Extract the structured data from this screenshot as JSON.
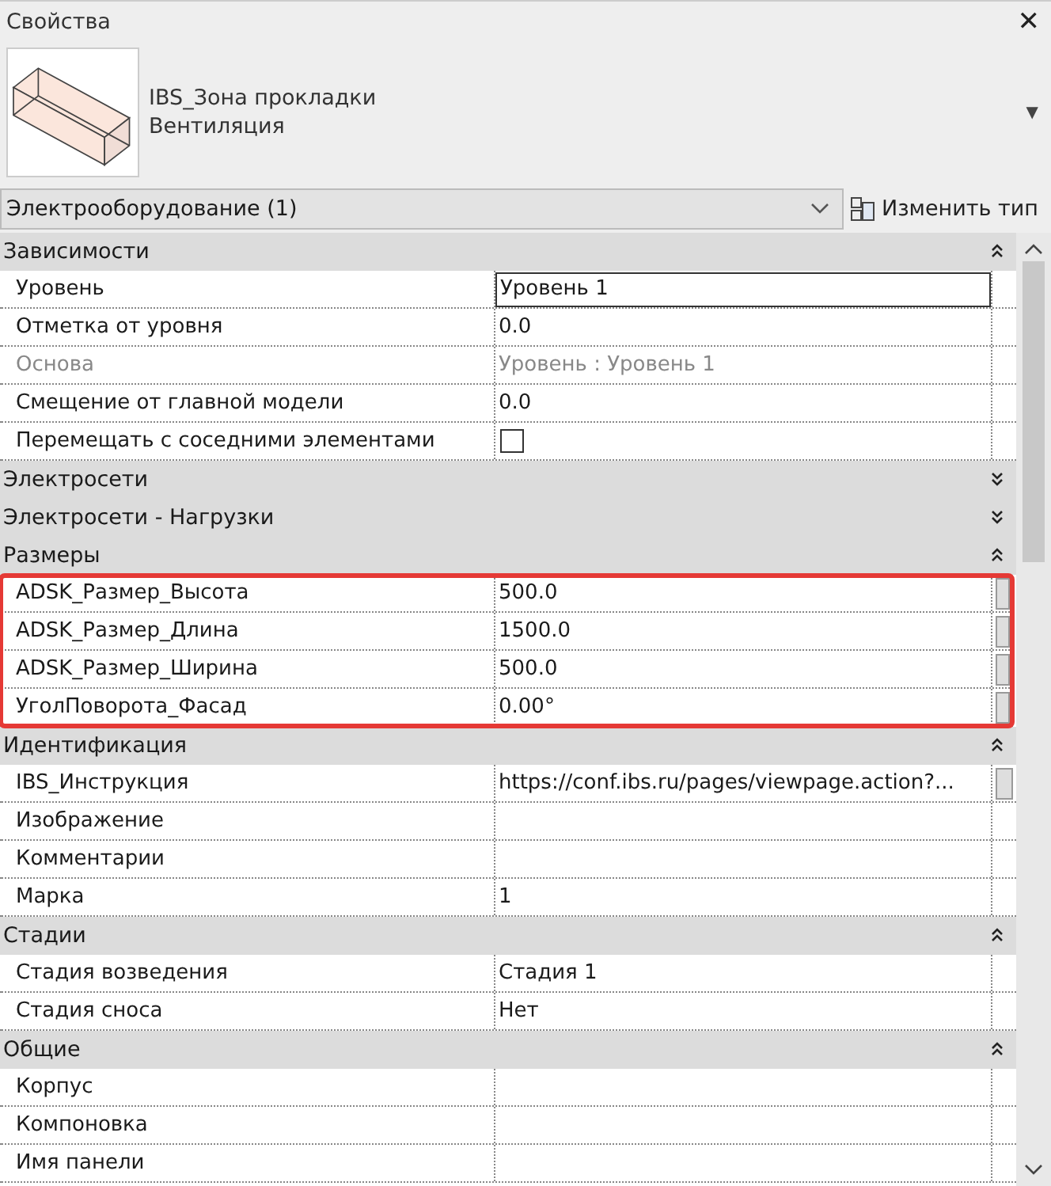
{
  "window": {
    "title": "Свойства",
    "close": "✕"
  },
  "type_selector": {
    "family": "IBS_Зона прокладки",
    "type": "Вентиляция",
    "dropdown": "▼"
  },
  "filter": {
    "value": "Электрооборудование (1)",
    "edit_type_button": "Изменить тип"
  },
  "groups": [
    {
      "name": "Зависимости",
      "expanded": true,
      "highlighted": false,
      "rows": [
        {
          "kind": "text",
          "label": "Уровень",
          "value": "Уровень 1",
          "editing": true,
          "disabled": false,
          "has_button": false
        },
        {
          "kind": "text",
          "label": "Отметка от уровня",
          "value": "0.0",
          "editing": false,
          "disabled": false,
          "has_button": false
        },
        {
          "kind": "text",
          "label": "Основа",
          "value": "Уровень : Уровень 1",
          "editing": false,
          "disabled": true,
          "has_button": false
        },
        {
          "kind": "text",
          "label": "Смещение от главной модели",
          "value": "0.0",
          "editing": false,
          "disabled": false,
          "has_button": false
        },
        {
          "kind": "checkbox",
          "label": "Перемещать с соседними элементами",
          "checked": false,
          "editing": false,
          "disabled": false,
          "has_button": false
        }
      ]
    },
    {
      "name": "Электросети",
      "expanded": false,
      "highlighted": false
    },
    {
      "name": "Электросети - Нагрузки",
      "expanded": false,
      "highlighted": false
    },
    {
      "name": "Размеры",
      "expanded": true,
      "highlighted": true,
      "rows": [
        {
          "kind": "text",
          "label": "ADSK_Размер_Высота",
          "value": "500.0",
          "editing": false,
          "disabled": false,
          "has_button": true
        },
        {
          "kind": "text",
          "label": "ADSK_Размер_Длина",
          "value": "1500.0",
          "editing": false,
          "disabled": false,
          "has_button": true
        },
        {
          "kind": "text",
          "label": "ADSK_Размер_Ширина",
          "value": "500.0",
          "editing": false,
          "disabled": false,
          "has_button": true
        },
        {
          "kind": "text",
          "label": "УголПоворота_Фасад",
          "value": "0.00°",
          "editing": false,
          "disabled": false,
          "has_button": true
        }
      ]
    },
    {
      "name": "Идентификация",
      "expanded": true,
      "highlighted": false,
      "rows": [
        {
          "kind": "text",
          "label": "IBS_Инструкция",
          "value": "https://conf.ibs.ru/pages/viewpage.action?...",
          "editing": false,
          "disabled": false,
          "has_button": true
        },
        {
          "kind": "text",
          "label": "Изображение",
          "editing": false,
          "disabled": false,
          "has_button": false
        },
        {
          "kind": "text",
          "label": "Комментарии",
          "editing": false,
          "disabled": false,
          "has_button": false
        },
        {
          "kind": "text",
          "label": "Марка",
          "value": "1",
          "editing": false,
          "disabled": false,
          "has_button": false
        }
      ]
    },
    {
      "name": "Стадии",
      "expanded": true,
      "highlighted": false,
      "rows": [
        {
          "kind": "text",
          "label": "Стадия возведения",
          "value": "Стадия 1",
          "editing": false,
          "disabled": false,
          "has_button": false
        },
        {
          "kind": "text",
          "label": "Стадия сноса",
          "value": "Нет",
          "editing": false,
          "disabled": false,
          "has_button": false
        }
      ]
    },
    {
      "name": "Общие",
      "expanded": true,
      "highlighted": false,
      "rows": [
        {
          "kind": "text",
          "label": "Корпус",
          "editing": false,
          "disabled": false,
          "has_button": false
        },
        {
          "kind": "text",
          "label": "Компоновка",
          "editing": false,
          "disabled": false,
          "has_button": false
        },
        {
          "kind": "text",
          "label": "Имя панели",
          "editing": false,
          "disabled": false,
          "has_button": false
        }
      ]
    }
  ]
}
